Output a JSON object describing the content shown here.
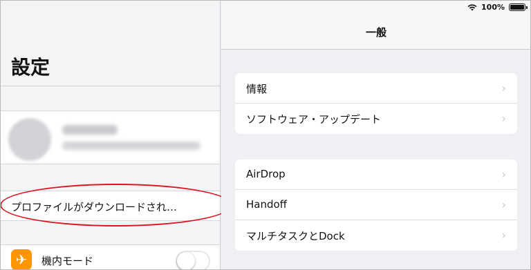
{
  "status_bar": {
    "battery": "100%"
  },
  "left": {
    "title": "設定",
    "profile_notice": "プロファイルがダウンロードされ…",
    "airplane_label": "機内モード",
    "airplane_on": false
  },
  "right": {
    "nav_title": "一般",
    "group1": [
      {
        "label": "情報"
      },
      {
        "label": "ソフトウェア・アップデート"
      }
    ],
    "group2": [
      {
        "label": "AirDrop"
      },
      {
        "label": "Handoff"
      },
      {
        "label": "マルチタスクとDock"
      }
    ],
    "chevron": "›"
  },
  "colors": {
    "highlight": "#d9141b",
    "airplane_icon": "#ff9500"
  },
  "icons": {
    "airplane": "airplane-icon",
    "wifi": "wifi-icon",
    "battery": "battery-icon"
  }
}
